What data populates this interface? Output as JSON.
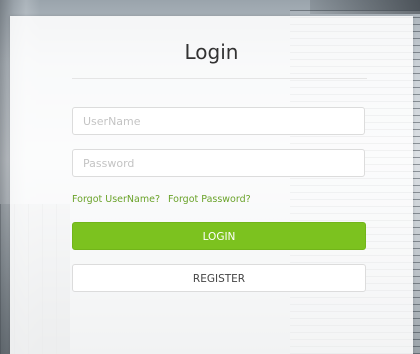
{
  "login": {
    "title": "Login",
    "username": {
      "placeholder": "UserName",
      "value": ""
    },
    "password": {
      "placeholder": "Password",
      "value": ""
    },
    "forgot_username": "Forgot UserName?",
    "forgot_password": "Forgot Password?",
    "login_button": "LOGIN",
    "register_button": "REGISTER"
  },
  "colors": {
    "accent": "#7cc21f",
    "link": "#6aa32a"
  }
}
